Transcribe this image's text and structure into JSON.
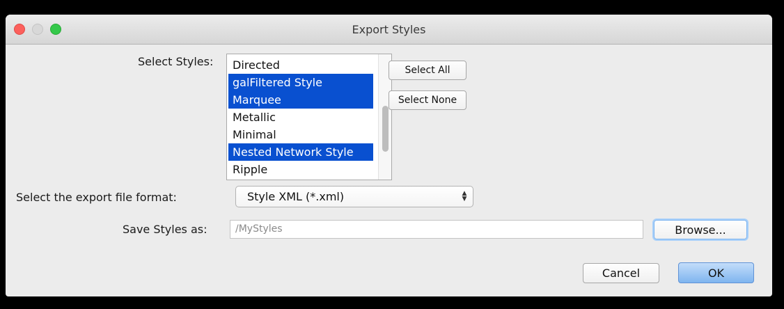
{
  "window": {
    "title": "Export Styles"
  },
  "select_styles": {
    "label": "Select Styles:",
    "items": [
      {
        "label": "Directed",
        "selected": false
      },
      {
        "label": "galFiltered Style",
        "selected": true
      },
      {
        "label": "Marquee",
        "selected": true
      },
      {
        "label": "Metallic",
        "selected": false
      },
      {
        "label": "Minimal",
        "selected": false
      },
      {
        "label": "Nested Network Style",
        "selected": true
      },
      {
        "label": "Ripple",
        "selected": false
      }
    ],
    "select_all_label": "Select All",
    "select_none_label": "Select None"
  },
  "format": {
    "label": "Select the export file format:",
    "value": "Style XML (*.xml)"
  },
  "save_as": {
    "label": "Save Styles as:",
    "placeholder": "/MyStyles",
    "browse_label": "Browse..."
  },
  "footer": {
    "cancel_label": "Cancel",
    "ok_label": "OK"
  },
  "colors": {
    "selection": "#0950d0",
    "close": "#fc605c",
    "minimize": "#d8d8d8",
    "maximize": "#34c84a"
  }
}
